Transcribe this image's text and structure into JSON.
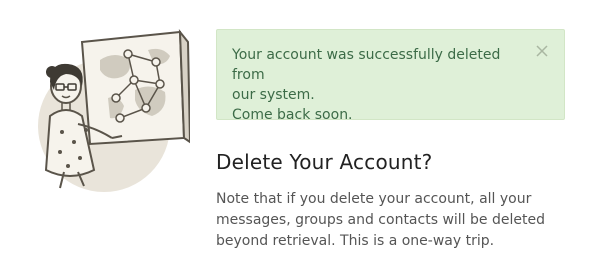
{
  "alert": {
    "line1": "Your account was successfully deleted from",
    "line2": "our system.",
    "line3": "Come back soon.",
    "close_icon": "close-icon",
    "background": "#dff0d8",
    "text_color": "#3c6b47"
  },
  "page": {
    "title": "Delete Your Account?",
    "description_line1": "Note that if you delete your account, all your",
    "description_line2": "messages, groups and contacts will be deleted",
    "description_line3": "beyond retrieval. This is a one-way trip."
  },
  "illustration": {
    "icon": "woman-with-map-illustration"
  }
}
